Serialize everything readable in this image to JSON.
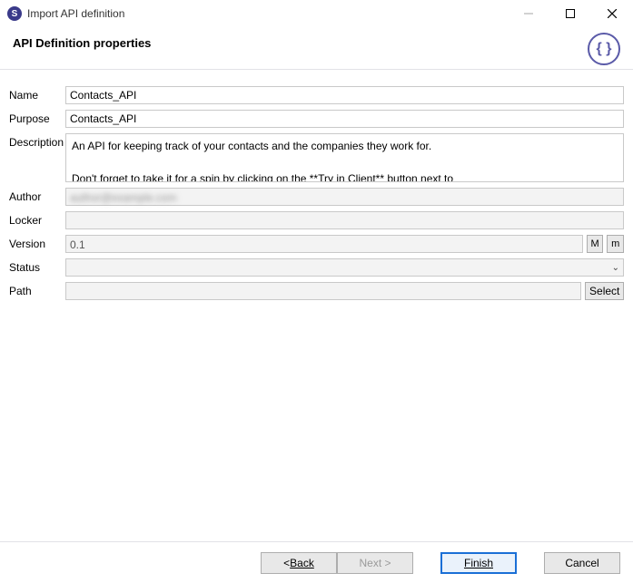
{
  "window": {
    "title": "Import API definition"
  },
  "header": {
    "heading": "API Definition properties",
    "braceGlyph": "{ }"
  },
  "fields": {
    "name": {
      "label": "Name",
      "value": "Contacts_API"
    },
    "purpose": {
      "label": "Purpose",
      "value": "Contacts_API"
    },
    "description": {
      "label": "Description",
      "value": "An API for keeping track of your contacts and the companies they work for.\n\nDon't forget to take it for a spin by clicking on the **Try in Client** button next to"
    },
    "author": {
      "label": "Author",
      "value": "author@example.com"
    },
    "locker": {
      "label": "Locker",
      "value": ""
    },
    "version": {
      "label": "Version",
      "value": "0.1",
      "majorBtn": "M",
      "minorBtn": "m"
    },
    "status": {
      "label": "Status",
      "value": ""
    },
    "path": {
      "label": "Path",
      "value": "",
      "selectBtn": "Select"
    }
  },
  "buttons": {
    "back": "Back",
    "backPrefix": "< ",
    "next": "Next >",
    "finish": "Finish",
    "cancel": "Cancel"
  }
}
